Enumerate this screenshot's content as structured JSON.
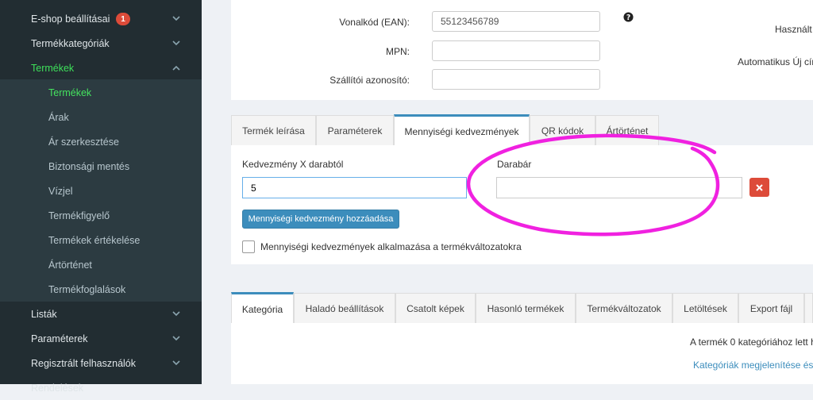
{
  "sidebar": {
    "items": [
      {
        "label": "E-shop beállításai",
        "badge": "1"
      },
      {
        "label": "Termékkategóriák"
      },
      {
        "label": "Termékek"
      },
      {
        "label": "Termékek"
      },
      {
        "label": "Árak"
      },
      {
        "label": "Ár szerkesztése"
      },
      {
        "label": "Biztonsági mentés"
      },
      {
        "label": "Vízjel"
      },
      {
        "label": "Termékfigyelő"
      },
      {
        "label": "Termékek értékelése"
      },
      {
        "label": "Ártörténet"
      },
      {
        "label": "Termékfoglalások"
      },
      {
        "label": "Listák"
      },
      {
        "label": "Paraméterek"
      },
      {
        "label": "Regisztrált felhasználók"
      },
      {
        "label": "Rendelések"
      }
    ]
  },
  "form": {
    "ean_label": "Vonalkód (EAN):",
    "ean_value": "55123456789",
    "mpn_label": "MPN:",
    "mpn_value": "",
    "supplier_label": "Szállítói azonosító:",
    "supplier_value": "",
    "right_text_1": "Használt",
    "right_text_2": "Automatikus Új cím"
  },
  "tabs_top": [
    "Termék leírása",
    "Paraméterek",
    "Mennyiségi kedvezmények",
    "QR kódok",
    "Ártörténet"
  ],
  "discount": {
    "qty_label": "Kedvezmény X darabtól",
    "qty_value": "5",
    "price_label": "Darabár",
    "price_value": "",
    "add_button": "Mennyiségi kedvezmény hozzáadása",
    "apply_label": "Mennyiségi kedvezmények alkalmazása a termékváltozatokra"
  },
  "tabs_bottom": [
    "Kategória",
    "Haladó beállítások",
    "Csatolt képek",
    "Hasonló termékek",
    "Termékváltozatok",
    "Letöltések",
    "Export fájl"
  ],
  "category": {
    "info_text": "A termék 0 kategóriához lett h",
    "show_link": "Kategóriák megjelenítése és"
  },
  "colors": {
    "sidebar_bg": "#222d32",
    "accent": "#3c8dbc",
    "active_green": "#3ee05a",
    "danger": "#dd4b39",
    "annotation": "#f021e0"
  }
}
